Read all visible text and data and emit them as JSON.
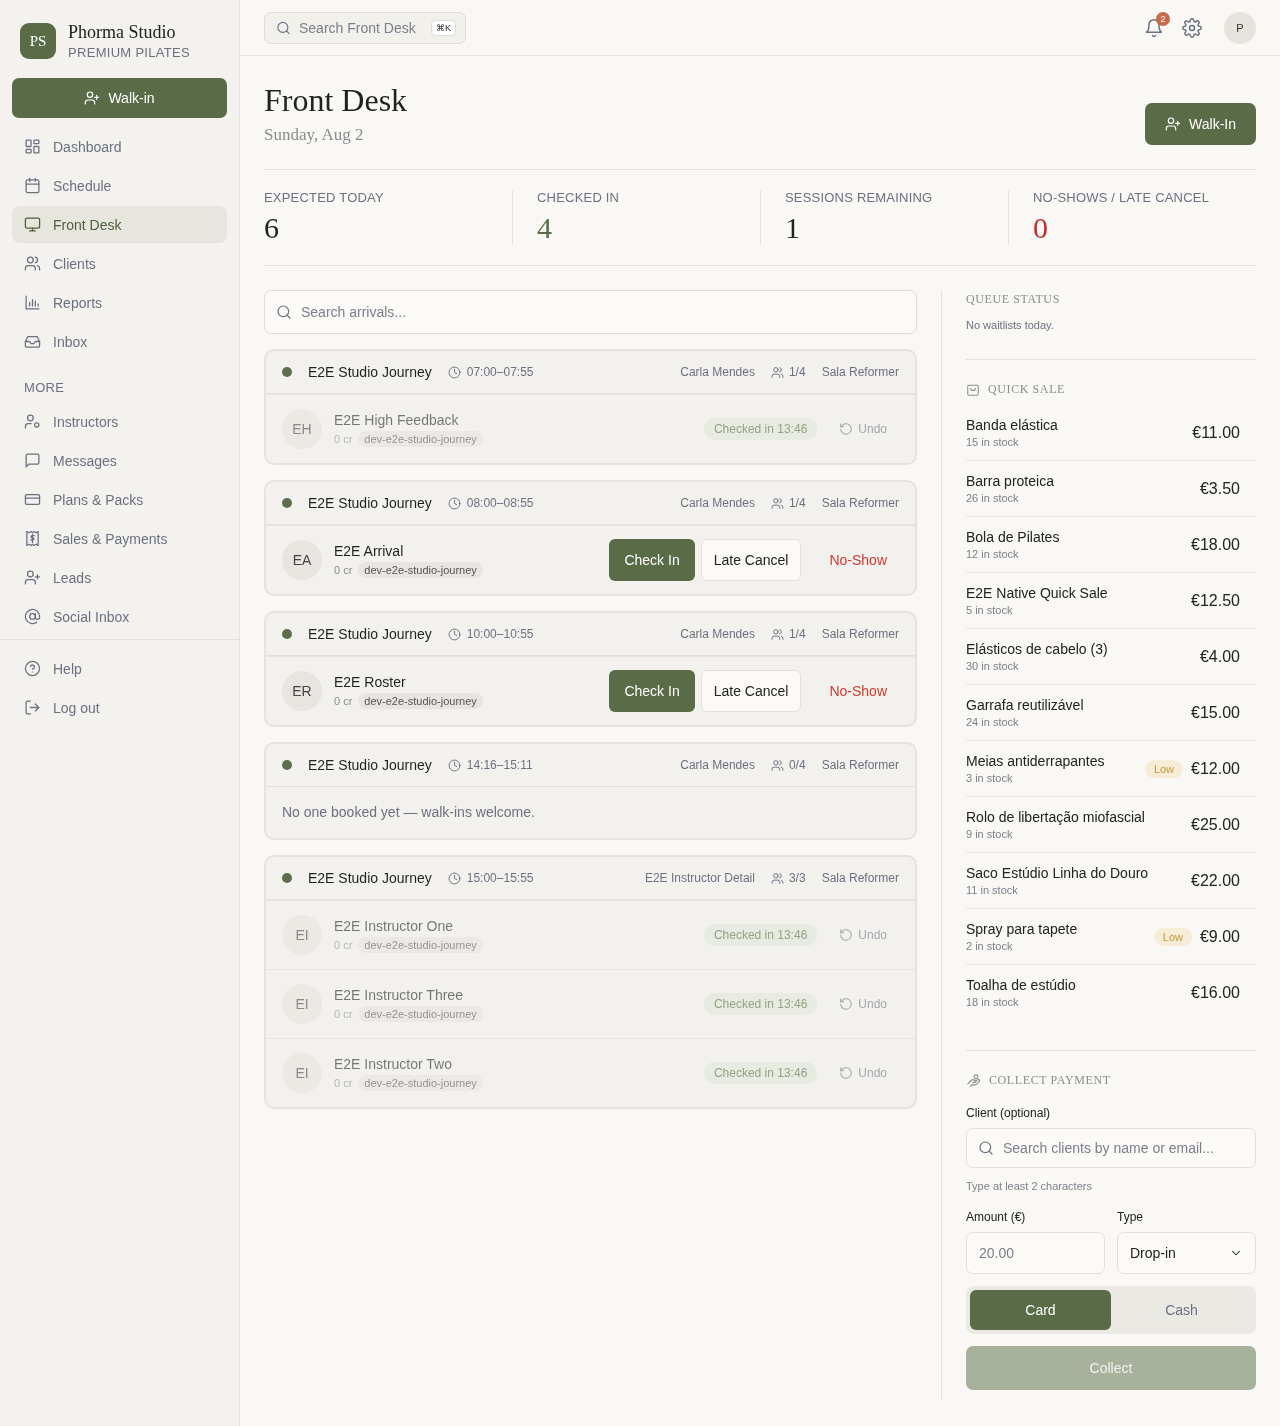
{
  "brand": {
    "initials": "PS",
    "name": "Phorma Studio",
    "tagline": "PREMIUM PILATES"
  },
  "sidebar": {
    "walk_in": "Walk-in",
    "items": [
      {
        "label": "Dashboard",
        "selected": false
      },
      {
        "label": "Schedule",
        "selected": false
      },
      {
        "label": "Front Desk",
        "selected": true
      },
      {
        "label": "Clients",
        "selected": false
      },
      {
        "label": "Reports",
        "selected": false
      },
      {
        "label": "Inbox",
        "selected": false
      }
    ],
    "more_heading": "MORE",
    "more_items": [
      {
        "label": "Instructors",
        "selected": false
      },
      {
        "label": "Messages",
        "selected": false
      },
      {
        "label": "Plans & Packs",
        "selected": false
      },
      {
        "label": "Sales & Payments",
        "selected": false
      },
      {
        "label": "Leads",
        "selected": false
      },
      {
        "label": "Social Inbox",
        "selected": false
      }
    ],
    "footer_items": [
      {
        "label": "Help"
      },
      {
        "label": "Log out"
      }
    ]
  },
  "topbar": {
    "search": {
      "placeholder": "Search Front Desk",
      "shortcut": "⌘K"
    },
    "notifications": "2",
    "avatar": "P"
  },
  "page": {
    "title": "Front Desk",
    "date": "Sunday, Aug 2",
    "walk_in": "Walk-In"
  },
  "stats": [
    {
      "label": "EXPECTED TODAY",
      "value": "6",
      "color": "#1f2320"
    },
    {
      "label": "CHECKED IN",
      "value": "4",
      "color": "#5a6b48"
    },
    {
      "label": "SESSIONS REMAINING",
      "value": "1",
      "color": "#1f2320"
    },
    {
      "label": "NO-SHOWS / LATE CANCEL",
      "value": "0",
      "color": "#c0302a"
    }
  ],
  "arrivals_search": {
    "placeholder": "Search arrivals..."
  },
  "sessions": [
    {
      "name": "E2E Studio Journey",
      "time": "07:00–07:55",
      "instructor": "Carla Mendes",
      "capacity": "1/4",
      "room": "Sala Reformer",
      "attendees": [
        {
          "initials": "EH",
          "name": "E2E High Feedback",
          "credits": "0 cr",
          "tag": "dev-e2e-studio-journey",
          "checked_in": true,
          "status": "Checked in 13:46",
          "undo": "Undo"
        }
      ]
    },
    {
      "name": "E2E Studio Journey",
      "time": "08:00–08:55",
      "instructor": "Carla Mendes",
      "capacity": "1/4",
      "room": "Sala Reformer",
      "attendees": [
        {
          "initials": "EA",
          "name": "E2E Arrival",
          "credits": "0 cr",
          "tag": "dev-e2e-studio-journey",
          "checked_in": false,
          "check_in": "Check In",
          "late_cancel": "Late Cancel",
          "no_show": "No-Show"
        }
      ]
    },
    {
      "name": "E2E Studio Journey",
      "time": "10:00–10:55",
      "instructor": "Carla Mendes",
      "capacity": "1/4",
      "room": "Sala Reformer",
      "attendees": [
        {
          "initials": "ER",
          "name": "E2E Roster",
          "credits": "0 cr",
          "tag": "dev-e2e-studio-journey",
          "checked_in": false,
          "check_in": "Check In",
          "late_cancel": "Late Cancel",
          "no_show": "No-Show"
        }
      ]
    },
    {
      "name": "E2E Studio Journey",
      "time": "14:16–15:11",
      "instructor": "Carla Mendes",
      "capacity": "0/4",
      "room": "Sala Reformer",
      "empty_text": "No one booked yet — walk-ins welcome."
    },
    {
      "name": "E2E Studio Journey",
      "time": "15:00–15:55",
      "instructor": "E2E Instructor Detail",
      "capacity": "3/3",
      "room": "Sala Reformer",
      "attendees": [
        {
          "initials": "EI",
          "name": "E2E Instructor One",
          "credits": "0 cr",
          "tag": "dev-e2e-studio-journey",
          "checked_in": true,
          "status": "Checked in 13:46",
          "undo": "Undo"
        },
        {
          "initials": "EI",
          "name": "E2E Instructor Three",
          "credits": "0 cr",
          "tag": "dev-e2e-studio-journey",
          "checked_in": true,
          "status": "Checked in 13:46",
          "undo": "Undo"
        },
        {
          "initials": "EI",
          "name": "E2E Instructor Two",
          "credits": "0 cr",
          "tag": "dev-e2e-studio-journey",
          "checked_in": true,
          "status": "Checked in 13:46",
          "undo": "Undo"
        }
      ]
    }
  ],
  "queue": {
    "title": "QUEUE STATUS",
    "text": "No waitlists today."
  },
  "quick_sale": {
    "title": "QUICK SALE",
    "items": [
      {
        "name": "Banda elástica",
        "stock": "15 in stock",
        "price": "€11.00",
        "low": false
      },
      {
        "name": "Barra proteica",
        "stock": "26 in stock",
        "price": "€3.50",
        "low": false
      },
      {
        "name": "Bola de Pilates",
        "stock": "12 in stock",
        "price": "€18.00",
        "low": false
      },
      {
        "name": "E2E Native Quick Sale",
        "stock": "5 in stock",
        "price": "€12.50",
        "low": false
      },
      {
        "name": "Elásticos de cabelo (3)",
        "stock": "30 in stock",
        "price": "€4.00",
        "low": false
      },
      {
        "name": "Garrafa reutilizável",
        "stock": "24 in stock",
        "price": "€15.00",
        "low": false
      },
      {
        "name": "Meias antiderrapantes",
        "stock": "3 in stock",
        "price": "€12.00",
        "low": true,
        "low_label": "Low"
      },
      {
        "name": "Rolo de libertação miofascial",
        "stock": "9 in stock",
        "price": "€25.00",
        "low": false
      },
      {
        "name": "Saco Estúdio Linha do Douro",
        "stock": "11 in stock",
        "price": "€22.00",
        "low": false
      },
      {
        "name": "Spray para tapete",
        "stock": "2 in stock",
        "price": "€9.00",
        "low": true,
        "low_label": "Low"
      },
      {
        "name": "Toalha de estúdio",
        "stock": "18 in stock",
        "price": "€16.00",
        "low": false
      }
    ]
  },
  "payment": {
    "title": "COLLECT PAYMENT",
    "client_label": "Client (optional)",
    "client_placeholder": "Search clients by name or email...",
    "hint": "Type at least 2 characters",
    "amount_label": "Amount (€)",
    "amount_placeholder": "20.00",
    "type_label": "Type",
    "type_value": "Drop-in",
    "methods": [
      {
        "label": "Card",
        "selected": true
      },
      {
        "label": "Cash",
        "selected": false
      }
    ],
    "collect": {
      "label": "Collect",
      "disabled": true
    }
  }
}
